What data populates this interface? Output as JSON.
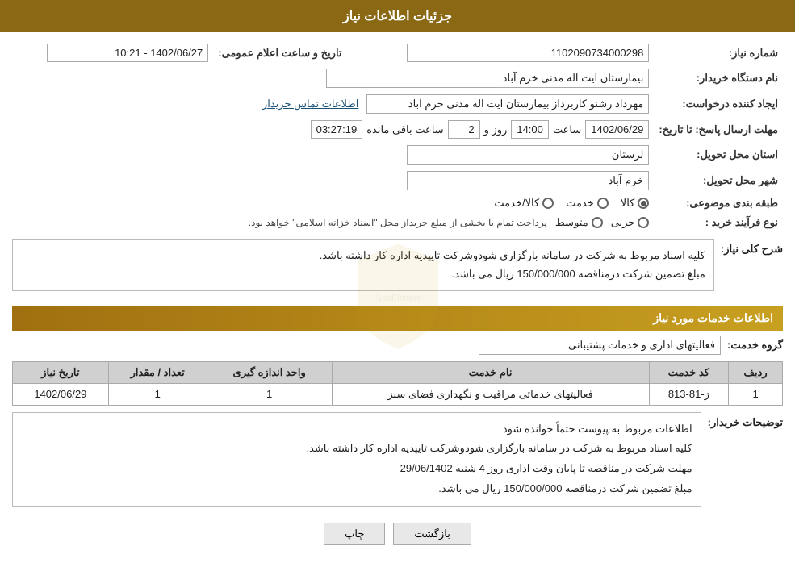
{
  "page": {
    "title": "جزئیات اطلاعات نیاز"
  },
  "fields": {
    "need_number_label": "شماره نیاز:",
    "need_number_value": "1102090734000298",
    "buyer_org_label": "نام دستگاه خریدار:",
    "buyer_org_value": "بیمارستان ایت اله مدنی خرم آباد",
    "creator_label": "ایجاد کننده درخواست:",
    "creator_value": "مهرداد رشنو کاربرداز بیمارستان ایت اله مدنی خرم آباد",
    "creator_link": "اطلاعات تماس خریدار",
    "send_deadline_label": "مهلت ارسال پاسخ: تا تاریخ:",
    "send_date": "1402/06/29",
    "send_time_label": "ساعت",
    "send_time": "14:00",
    "send_days_label": "روز و",
    "send_days": "2",
    "send_remaining_label": "ساعت باقی مانده",
    "send_remaining": "03:27:19",
    "announce_date_label": "تاریخ و ساعت اعلام عمومی:",
    "announce_datetime": "1402/06/27 - 10:21",
    "delivery_province_label": "استان محل تحویل:",
    "delivery_province": "لرستان",
    "delivery_city_label": "شهر محل تحویل:",
    "delivery_city": "خرم آباد",
    "category_label": "طبقه بندی موضوعی:",
    "category_options": [
      {
        "label": "کالا",
        "selected": true
      },
      {
        "label": "خدمت",
        "selected": false
      },
      {
        "label": "کالا/خدمت",
        "selected": false
      }
    ],
    "purchase_type_label": "نوع فرآیند خرید :",
    "purchase_type_options": [
      {
        "label": "جزیی",
        "selected": false
      },
      {
        "label": "متوسط",
        "selected": false
      }
    ],
    "purchase_type_desc": "پرداخت تمام یا بخشی از مبلغ خریداز محل \"اسناد خزانه اسلامی\" خواهد بود.",
    "general_desc_section": "شرح کلی نیاز:",
    "general_desc": "کلیه اسناد مربوط به شرکت در سامانه بارگزاری شودوشرکت تایپدیه اداره کار داشته باشد.\nمبلغ تضمین شرکت درمناقصه 150/000/000 ریال می باشد.",
    "services_section": "اطلاعات خدمات مورد نیاز",
    "service_group_label": "گروه خدمت:",
    "service_group_value": "فعالیتهای اداری و خدمات پشتیبانی",
    "table_headers": {
      "row_num": "ردیف",
      "service_code": "کد خدمت",
      "service_name": "نام خدمت",
      "unit": "واحد اندازه گیری",
      "quantity": "تعداد / مقدار",
      "need_date": "تاریخ نیاز"
    },
    "table_rows": [
      {
        "row": "1",
        "code": "ز-81-813",
        "name": "فعالیتهای خدماتی مراقبت و نگهداری فضای سبز",
        "unit": "1",
        "quantity": "1",
        "date": "1402/06/29"
      }
    ],
    "buyer_desc_label": "توضیحات خریدار:",
    "buyer_desc": "اطلاعات مربوط به پیوست حتماً خوانده شود\nکلیه اسناد مربوط به شرکت در سامانه بارگزاری شودوشرکت تایپدیه اداره کار داشته باشد.\nمهلت شرکت در مناقصه تا پایان وقت اداری روز 4 شنبه 29/06/1402\nمبلغ تضمین شرکت درمناقصه 150/000/000 ریال می باشد.",
    "btn_print": "چاپ",
    "btn_back": "بازگشت"
  }
}
